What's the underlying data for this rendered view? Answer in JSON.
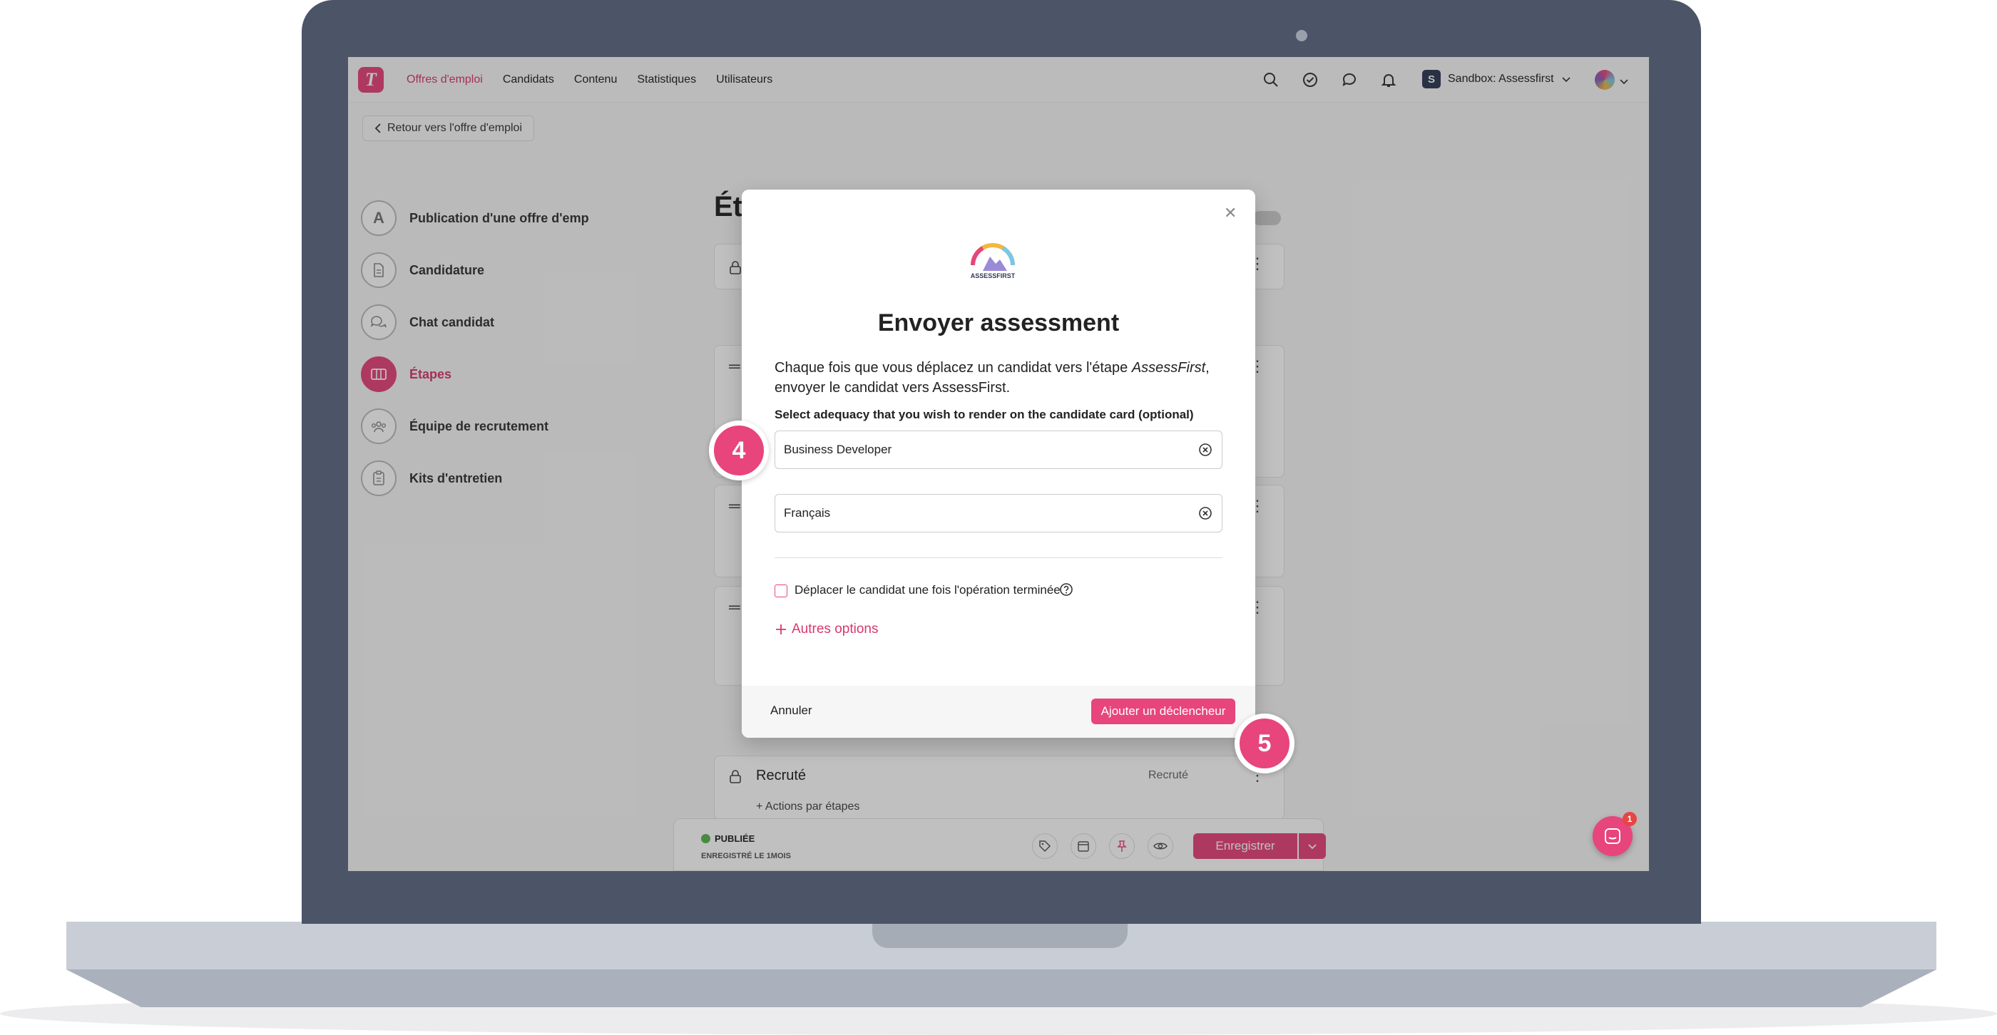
{
  "nav": {
    "logo": "T",
    "links": [
      "Offres d'emploi",
      "Candidats",
      "Contenu",
      "Statistiques",
      "Utilisateurs"
    ],
    "sandbox_badge": "S",
    "sandbox_label": "Sandbox: Assessfirst"
  },
  "back_button": "Retour vers l'offre d'emploi",
  "sidebar": {
    "items": [
      {
        "letter": "A",
        "label": "Publication d'une offre d'emp"
      },
      {
        "letter": "",
        "label": "Candidature"
      },
      {
        "letter": "",
        "label": "Chat candidat"
      },
      {
        "letter": "",
        "label": "Étapes"
      },
      {
        "letter": "",
        "label": "Équipe de recrutement"
      },
      {
        "letter": "",
        "label": "Kits d'entretien"
      }
    ]
  },
  "page": {
    "title": "Ét",
    "last_stage_label": "Recruté",
    "last_stage_right": "Recruté",
    "actions_label": "+ Actions par étapes"
  },
  "bottom_bar": {
    "status": "PUBLIÉE",
    "saved": "ENREGISTRÉ LE 1MOIS",
    "save_label": "Enregistrer"
  },
  "chat": {
    "badge": "1"
  },
  "modal": {
    "logo_text": "ASSESSFIRST",
    "title": "Envoyer assessment",
    "desc_part1": "Chaque fois que vous déplacez un candidat vers l'étape ",
    "desc_em": "AssessFirst",
    "desc_part2": ", envoyer le candidat vers AssessFirst.",
    "select_label": "Select adequacy that you wish to render on the candidate card (optional)",
    "field1": "Business Developer",
    "field2": "Français",
    "checkbox_label": "Déplacer le candidat une fois l'opération terminée",
    "more_options": "Autres options",
    "cancel": "Annuler",
    "submit": "Ajouter un déclencheur"
  },
  "steps": [
    "4",
    "5"
  ],
  "colors": {
    "accent": "#e7457b",
    "laptop": "#4c5567"
  }
}
